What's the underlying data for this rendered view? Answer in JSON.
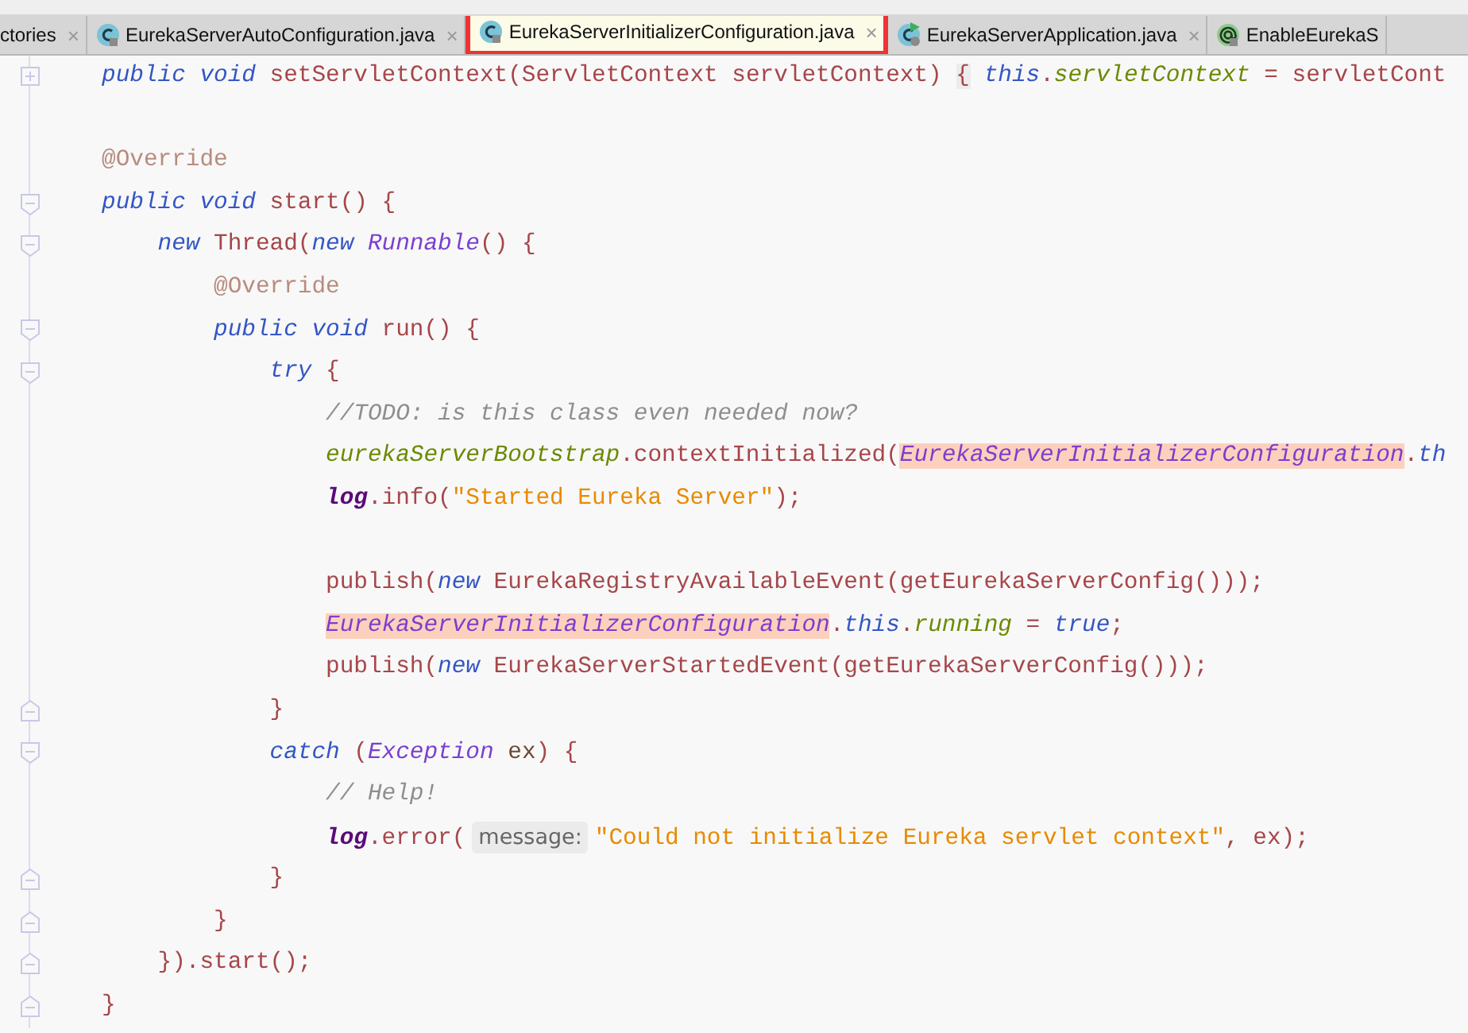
{
  "tabs": [
    {
      "label": "ctories",
      "close": "×",
      "selected": false
    },
    {
      "label": "EurekaServerAutoConfiguration.java",
      "kind": "class",
      "close": "×",
      "selected": false
    },
    {
      "label": "EurekaServerInitializerConfiguration.java",
      "kind": "class",
      "close": "×",
      "selected": true
    },
    {
      "label": "EurekaServerApplication.java",
      "kind": "runnable-class",
      "close": "×",
      "selected": false
    },
    {
      "label": "EnableEurekaS",
      "kind": "annotation",
      "selected": false
    }
  ],
  "editor": {
    "lines": [
      {
        "kind": "fold-expand",
        "tokens": [
          {
            "kind": "keyword",
            "text": "public void"
          },
          {
            "kind": "plain",
            "text": " setServletContext(ServletContext servletContext) "
          },
          {
            "kind": "folded",
            "text": "{"
          },
          {
            "kind": "keyword",
            "text": " this"
          },
          {
            "kind": "plain",
            "text": "."
          },
          {
            "kind": "field",
            "text": "servletContext"
          },
          {
            "kind": "plain",
            "text": " = servletCont"
          }
        ]
      },
      {
        "kind": "blank"
      },
      {
        "tokens": [
          {
            "kind": "annotation",
            "text": "@Override"
          }
        ]
      },
      {
        "kind": "fold-start",
        "tokens": [
          {
            "kind": "keyword",
            "text": "public void"
          },
          {
            "kind": "plain",
            "text": " start() {"
          }
        ],
        "children": [
          {
            "kind": "fold-start",
            "tokens": [
              {
                "kind": "keyword",
                "text": "new"
              },
              {
                "kind": "plain",
                "text": " Thread("
              },
              {
                "kind": "keyword",
                "text": "new"
              },
              {
                "kind": "type",
                "text": " Runnable"
              },
              {
                "kind": "plain",
                "text": "() {"
              }
            ],
            "children": [
              {
                "tokens": [
                  {
                    "kind": "annotation",
                    "text": "@Override"
                  }
                ]
              },
              {
                "kind": "fold-start",
                "tokens": [
                  {
                    "kind": "keyword",
                    "text": "public void"
                  },
                  {
                    "kind": "plain",
                    "text": " run() {"
                  }
                ],
                "children": [
                  {
                    "kind": "fold-start",
                    "tokens": [
                      {
                        "kind": "keyword",
                        "text": "try"
                      },
                      {
                        "kind": "plain",
                        "text": " {"
                      }
                    ],
                    "children": [
                      {
                        "tokens": [
                          {
                            "kind": "comment",
                            "text": "//TODO: is this class even needed now?"
                          }
                        ]
                      },
                      {
                        "tokens": [
                          {
                            "kind": "field",
                            "text": "eurekaServerBootstrap"
                          },
                          {
                            "kind": "plain",
                            "text": ".contextInitialized("
                          },
                          {
                            "kind": "type",
                            "text": "EurekaServerInitializerConfiguration",
                            "highlighted": true
                          },
                          {
                            "kind": "plain",
                            "text": "."
                          },
                          {
                            "kind": "keyword",
                            "text": "th"
                          }
                        ]
                      },
                      {
                        "tokens": [
                          {
                            "kind": "static",
                            "text": "log"
                          },
                          {
                            "kind": "plain",
                            "text": ".info("
                          },
                          {
                            "kind": "string",
                            "text": "\"Started Eureka Server\""
                          },
                          {
                            "kind": "plain",
                            "text": ");"
                          }
                        ]
                      },
                      {
                        "kind": "blank"
                      },
                      {
                        "tokens": [
                          {
                            "kind": "plain",
                            "text": "publish("
                          },
                          {
                            "kind": "keyword",
                            "text": "new"
                          },
                          {
                            "kind": "plain",
                            "text": " EurekaRegistryAvailableEvent(getEurekaServerConfig()));"
                          }
                        ]
                      },
                      {
                        "tokens": [
                          {
                            "kind": "type",
                            "text": "EurekaServerInitializerConfiguration",
                            "highlighted": true
                          },
                          {
                            "kind": "plain",
                            "text": "."
                          },
                          {
                            "kind": "keyword",
                            "text": "this"
                          },
                          {
                            "kind": "plain",
                            "text": "."
                          },
                          {
                            "kind": "field",
                            "text": "running"
                          },
                          {
                            "kind": "plain",
                            "text": " ="
                          },
                          {
                            "kind": "keyword",
                            "text": " true"
                          },
                          {
                            "kind": "plain",
                            "text": ";"
                          }
                        ]
                      },
                      {
                        "tokens": [
                          {
                            "kind": "plain",
                            "text": "publish("
                          },
                          {
                            "kind": "keyword",
                            "text": "new"
                          },
                          {
                            "kind": "plain",
                            "text": " EurekaServerStartedEvent(getEurekaServerConfig()));"
                          }
                        ]
                      }
                    ]
                  },
                  {
                    "kind": "fold-end",
                    "tokens": [
                      {
                        "kind": "plain",
                        "text": "}"
                      }
                    ]
                  },
                  {
                    "kind": "fold-start",
                    "tokens": [
                      {
                        "kind": "keyword",
                        "text": "catch"
                      },
                      {
                        "kind": "plain",
                        "text": " ("
                      },
                      {
                        "kind": "type",
                        "text": "Exception"
                      },
                      {
                        "kind": "param",
                        "text": " ex"
                      },
                      {
                        "kind": "plain",
                        "text": ") {"
                      }
                    ],
                    "children": [
                      {
                        "tokens": [
                          {
                            "kind": "comment",
                            "text": "// Help!"
                          }
                        ]
                      },
                      {
                        "tokens": [
                          {
                            "kind": "static",
                            "text": "log"
                          },
                          {
                            "kind": "plain",
                            "text": ".error("
                          },
                          {
                            "kind": "hint",
                            "text": "message:"
                          },
                          {
                            "kind": "string",
                            "text": "\"Could not initialize Eureka servlet context\""
                          },
                          {
                            "kind": "plain",
                            "text": ", ex);"
                          }
                        ]
                      }
                    ]
                  },
                  {
                    "kind": "fold-end",
                    "tokens": [
                      {
                        "kind": "plain",
                        "text": "}"
                      }
                    ]
                  }
                ]
              },
              {
                "kind": "fold-end",
                "tokens": [
                  {
                    "kind": "plain",
                    "text": "}"
                  }
                ]
              }
            ]
          },
          {
            "kind": "fold-end",
            "tokens": [
              {
                "kind": "plain",
                "text": "}).start();"
              }
            ]
          }
        ]
      },
      {
        "kind": "fold-end",
        "tokens": [
          {
            "kind": "plain",
            "text": "}"
          }
        ]
      }
    ]
  }
}
